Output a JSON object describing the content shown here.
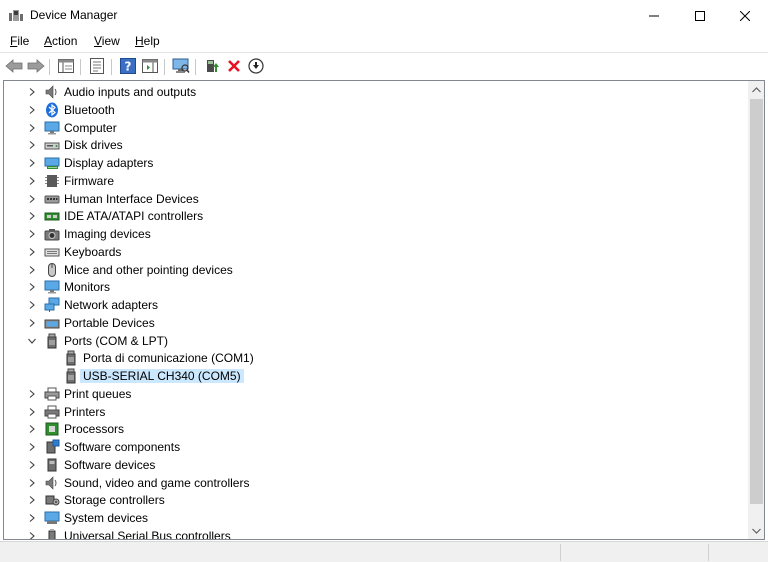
{
  "window": {
    "title": "Device Manager",
    "minimize_glyph": "minimize-icon",
    "maximize_glyph": "maximize-icon",
    "close_glyph": "close-icon"
  },
  "menu": [
    {
      "label": "File",
      "mnemonic": "F",
      "rest": "ile"
    },
    {
      "label": "Action",
      "mnemonic": "A",
      "rest": "ction"
    },
    {
      "label": "View",
      "mnemonic": "V",
      "rest": "iew"
    },
    {
      "label": "Help",
      "mnemonic": "H",
      "rest": "elp"
    }
  ],
  "toolbar": [
    "back-arrow-icon",
    "forward-arrow-icon",
    "show-hide-console-tree-icon",
    "properties-icon",
    "help-icon",
    "action-pane-icon",
    "scan-hardware-icon",
    "update-driver-icon",
    "uninstall-device-icon",
    "disable-device-icon"
  ],
  "tree": [
    {
      "label": "Audio inputs and outputs",
      "icon": "speaker-icon",
      "level": 0,
      "expanded": false
    },
    {
      "label": "Bluetooth",
      "icon": "bluetooth-icon",
      "level": 0,
      "expanded": false
    },
    {
      "label": "Computer",
      "icon": "computer-icon",
      "level": 0,
      "expanded": false
    },
    {
      "label": "Disk drives",
      "icon": "disk-drive-icon",
      "level": 0,
      "expanded": false
    },
    {
      "label": "Display adapters",
      "icon": "display-adapter-icon",
      "level": 0,
      "expanded": false
    },
    {
      "label": "Firmware",
      "icon": "firmware-icon",
      "level": 0,
      "expanded": false
    },
    {
      "label": "Human Interface Devices",
      "icon": "hid-icon",
      "level": 0,
      "expanded": false
    },
    {
      "label": "IDE ATA/ATAPI controllers",
      "icon": "ide-controller-icon",
      "level": 0,
      "expanded": false
    },
    {
      "label": "Imaging devices",
      "icon": "camera-icon",
      "level": 0,
      "expanded": false
    },
    {
      "label": "Keyboards",
      "icon": "keyboard-icon",
      "level": 0,
      "expanded": false
    },
    {
      "label": "Mice and other pointing devices",
      "icon": "mouse-icon",
      "level": 0,
      "expanded": false
    },
    {
      "label": "Monitors",
      "icon": "monitor-icon",
      "level": 0,
      "expanded": false
    },
    {
      "label": "Network adapters",
      "icon": "network-adapter-icon",
      "level": 0,
      "expanded": false
    },
    {
      "label": "Portable Devices",
      "icon": "portable-device-icon",
      "level": 0,
      "expanded": false
    },
    {
      "label": "Ports (COM & LPT)",
      "icon": "port-icon",
      "level": 0,
      "expanded": true
    },
    {
      "label": "Porta di comunicazione (COM1)",
      "icon": "port-icon",
      "level": 1,
      "expanded": null
    },
    {
      "label": "USB-SERIAL CH340 (COM5)",
      "icon": "port-icon",
      "level": 1,
      "expanded": null,
      "selected": true
    },
    {
      "label": "Print queues",
      "icon": "print-queue-icon",
      "level": 0,
      "expanded": false
    },
    {
      "label": "Printers",
      "icon": "printer-icon",
      "level": 0,
      "expanded": false
    },
    {
      "label": "Processors",
      "icon": "processor-icon",
      "level": 0,
      "expanded": false
    },
    {
      "label": "Software components",
      "icon": "software-component-icon",
      "level": 0,
      "expanded": false
    },
    {
      "label": "Software devices",
      "icon": "software-device-icon",
      "level": 0,
      "expanded": false
    },
    {
      "label": "Sound, video and game controllers",
      "icon": "speaker-icon",
      "level": 0,
      "expanded": false
    },
    {
      "label": "Storage controllers",
      "icon": "storage-controller-icon",
      "level": 0,
      "expanded": false
    },
    {
      "label": "System devices",
      "icon": "system-device-icon",
      "level": 0,
      "expanded": false
    },
    {
      "label": "Universal Serial Bus controllers",
      "icon": "usb-controller-icon",
      "level": 0,
      "expanded": false
    }
  ],
  "colors": {
    "selection": "#cce8ff",
    "accent_blue": "#2a7fd4",
    "uninstall_red": "#e81123",
    "update_green": "#2f8f2f"
  }
}
